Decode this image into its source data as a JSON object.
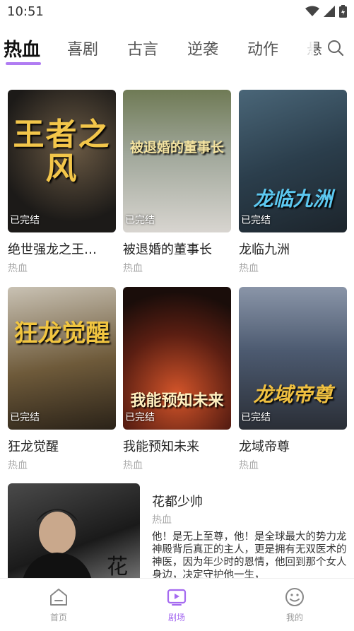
{
  "status": {
    "time": "10:51"
  },
  "tabs": [
    {
      "label": "热血"
    },
    {
      "label": "喜剧"
    },
    {
      "label": "古言"
    },
    {
      "label": "逆袭"
    },
    {
      "label": "动作"
    },
    {
      "label": "悬"
    }
  ],
  "cards": [
    {
      "title": "绝世强龙之王…",
      "genre": "热血",
      "status": "已完结",
      "poster_text": "王者之风"
    },
    {
      "title": "被退婚的董事长",
      "genre": "热血",
      "status": "已完结",
      "poster_text": "被退婚的董事长"
    },
    {
      "title": "龙临九洲",
      "genre": "热血",
      "status": "已完结",
      "poster_text": "龙临九洲"
    },
    {
      "title": "狂龙觉醒",
      "genre": "热血",
      "status": "已完结",
      "poster_text": "狂龙觉醒"
    },
    {
      "title": "我能预知未来",
      "genre": "热血",
      "status": "已完结",
      "poster_text": "我能预知未来"
    },
    {
      "title": "龙域帝尊",
      "genre": "热血",
      "status": "已完结",
      "poster_text": "龙域帝尊"
    }
  ],
  "featured": {
    "title": "花都少帅",
    "genre": "热血",
    "description": "他！是无上至尊，他！是全球最大的势力龙神殿背后真正的主人，更是拥有无双医术的神医，因为年少时的恩情，他回到那个女人身边，决定守护他一生，"
  },
  "bottom_nav": [
    {
      "label": "首页"
    },
    {
      "label": "剧场"
    },
    {
      "label": "我的"
    }
  ],
  "colors": {
    "accent": "#a56af0",
    "tab_indicator": "#b07cf2"
  }
}
